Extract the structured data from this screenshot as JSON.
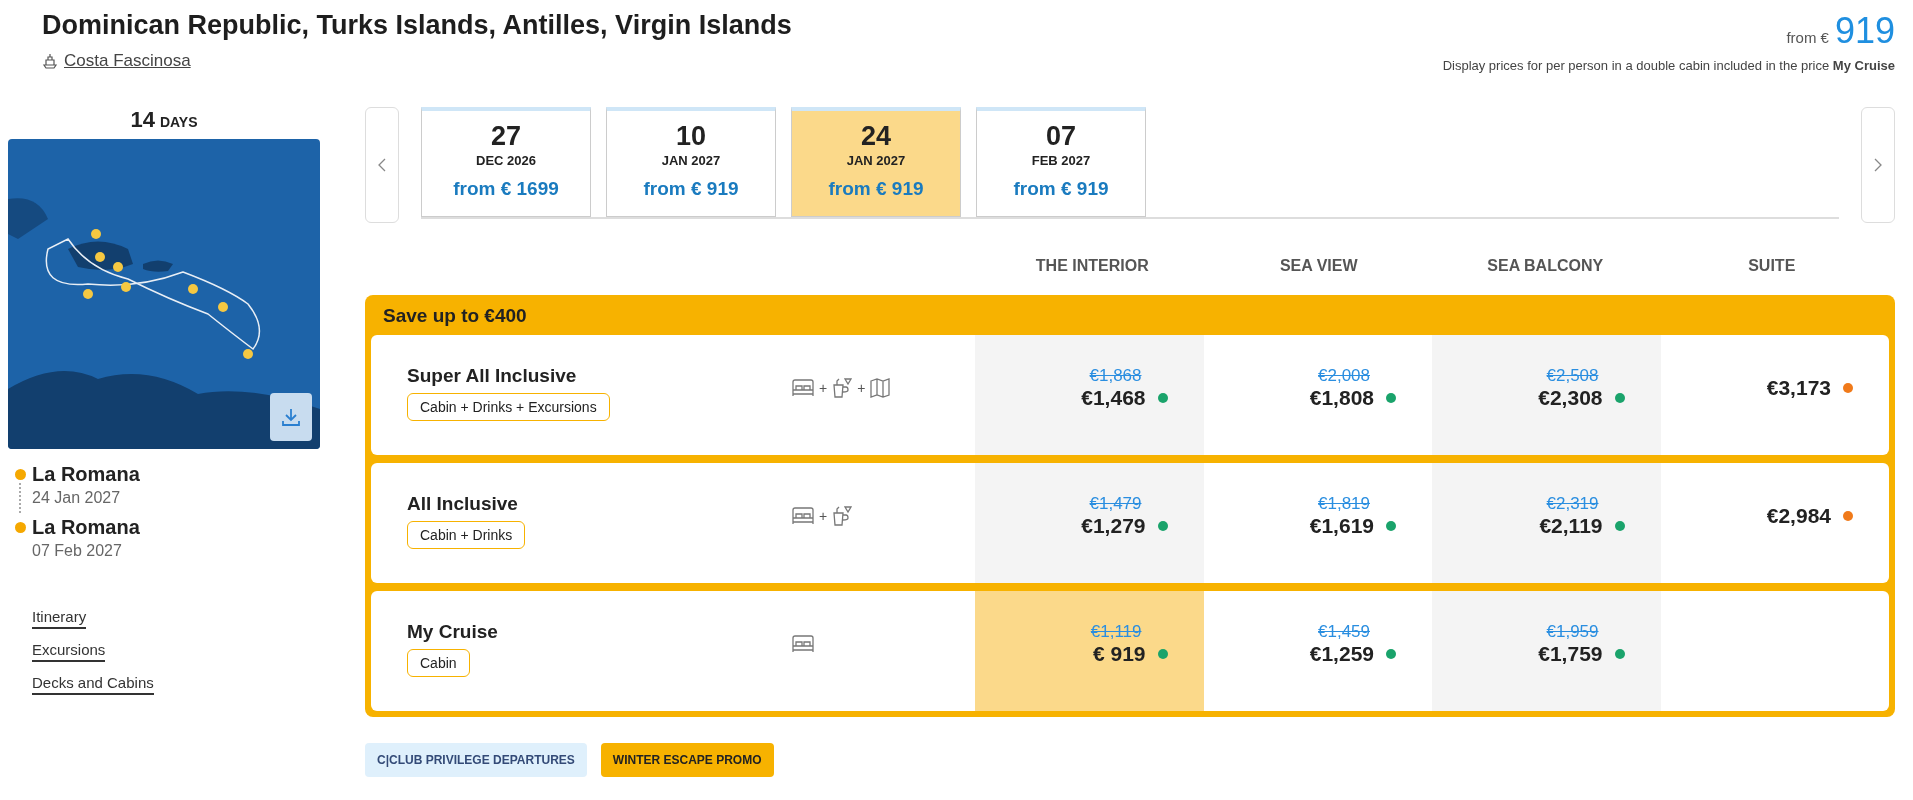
{
  "title": "Dominican Republic, Turks Islands, Antilles, Virgin Islands",
  "ship": "Costa Fascinosa",
  "from_label": "from €",
  "from_price": "919",
  "price_note": "Display prices for per person in a double cabin included in the price **My Cruise**",
  "duration": {
    "number": "14",
    "unit": "DAYS"
  },
  "map": {
    "kind": "picture"
  },
  "stops": [
    {
      "name": "La Romana",
      "date": "24 Jan 2027"
    },
    {
      "name": "La Romana",
      "date": "07 Feb 2027"
    }
  ],
  "links": [
    "Itinerary",
    "Excursions",
    "Decks and Cabins"
  ],
  "dates": [
    {
      "day": "27",
      "month": "DEC 2026",
      "price": "from € 1699",
      "selected": false
    },
    {
      "day": "10",
      "month": "JAN 2027",
      "price": "from € 919",
      "selected": false
    },
    {
      "day": "24",
      "month": "JAN 2027",
      "price": "from € 919",
      "selected": true
    },
    {
      "day": "07",
      "month": "FEB 2027",
      "price": "from € 919",
      "selected": false
    }
  ],
  "columns": [
    "THE INTERIOR",
    "SEA VIEW",
    "SEA BALCONY",
    "SUITE"
  ],
  "promo_title": "Save up to €400",
  "plans": [
    {
      "name": "Super All Inclusive",
      "tag": "Cabin + Drinks + Excursions",
      "includes": [
        {
          "kind": "bed"
        },
        {
          "kind": "plus",
          "text": "+"
        },
        {
          "kind": "drinks"
        },
        {
          "kind": "plus",
          "text": "+"
        },
        {
          "kind": "map"
        }
      ],
      "prices": [
        {
          "old": "€1,868",
          "price": "€1,468",
          "color": "#1aa36b",
          "selected": false
        },
        {
          "old": "€2,008",
          "price": "€1,808",
          "color": "#1aa36b",
          "selected": false
        },
        {
          "old": "€2,508",
          "price": "€2,308",
          "color": "#1aa36b",
          "selected": false
        },
        {
          "price": "€3,173",
          "color": "#f07a1a",
          "selected": false
        }
      ]
    },
    {
      "name": "All Inclusive",
      "tag": "Cabin + Drinks",
      "includes": [
        {
          "kind": "bed"
        },
        {
          "kind": "plus",
          "text": "+"
        },
        {
          "kind": "drinks"
        }
      ],
      "prices": [
        {
          "old": "€1,479",
          "price": "€1,279",
          "color": "#1aa36b",
          "selected": false
        },
        {
          "old": "€1,819",
          "price": "€1,619",
          "color": "#1aa36b",
          "selected": false
        },
        {
          "old": "€2,319",
          "price": "€2,119",
          "color": "#1aa36b",
          "selected": false
        },
        {
          "price": "€2,984",
          "color": "#f07a1a",
          "selected": false
        }
      ]
    },
    {
      "name": "My Cruise",
      "tag": "Cabin",
      "includes": [
        {
          "kind": "bed"
        }
      ],
      "prices": [
        {
          "old": "€1,119",
          "price": "€ 919",
          "color": "#1aa36b",
          "selected": true
        },
        {
          "old": "€1,459",
          "price": "€1,259",
          "color": "#1aa36b",
          "selected": false
        },
        {
          "old": "€1,959",
          "price": "€1,759",
          "color": "#1aa36b",
          "selected": false
        }
      ]
    }
  ],
  "badges": [
    {
      "text": "C|CLUB PRIVILEGE DEPARTURES",
      "kind": "club"
    },
    {
      "text": "WINTER ESCAPE PROMO",
      "kind": "promo"
    }
  ]
}
